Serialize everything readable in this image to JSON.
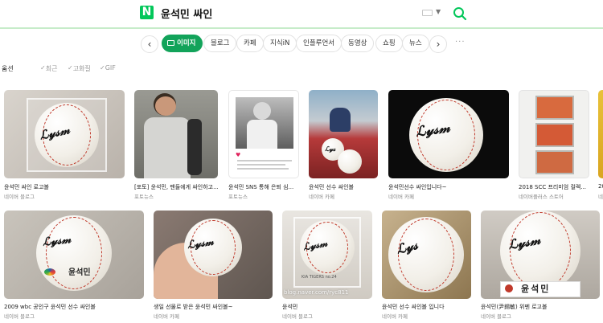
{
  "header": {
    "logo_letter": "N",
    "query": "윤석민 싸인"
  },
  "tabs": {
    "prev": "‹",
    "next": "›",
    "items": [
      "이미지",
      "블로그",
      "카페",
      "지식iN",
      "인플루언서",
      "동영상",
      "쇼핑",
      "뉴스"
    ],
    "more": "···"
  },
  "filters": {
    "options": "옵션",
    "recent": "최근",
    "hires": "고화질",
    "gif": "GIF"
  },
  "results_row1": [
    {
      "caption": "윤석민 싸인 로고볼",
      "source": "네이버 블로그"
    },
    {
      "caption": "[포토] 윤석민, 팬들에게 싸인하고...",
      "source": "포토뉴스"
    },
    {
      "caption": "윤석민 SNS 통해 은퇴 심...",
      "source": "포토뉴스"
    },
    {
      "caption": "윤석민 선수 싸인볼",
      "source": "네이버 카페"
    },
    {
      "caption": "윤석민선수 싸인입니다~",
      "source": "네이버 카페"
    },
    {
      "caption": "2018 SCC 프리미엄 컬렉...",
      "source": "네이버플러스 스토어"
    },
    {
      "caption": "20",
      "source": "네"
    }
  ],
  "results_row2": [
    {
      "caption": "2009 wbc 공인구 윤석민 선수 싸인볼",
      "source": "네이버 블로그"
    },
    {
      "caption": "생일 선물로 받은 윤석민 싸인볼~",
      "source": "네이버 카페"
    },
    {
      "caption": "윤석민",
      "source": "네이버 블로그"
    },
    {
      "caption": "윤석민 선수 싸인볼 입니다",
      "source": "네이버 카페"
    },
    {
      "caption": "윤석민(尹錫敏) 위펜 로고볼",
      "source": "네이버 블로그"
    }
  ],
  "image_text": {
    "name_plate": "윤석민",
    "watermark": "blog.naver.com/ryc811",
    "case_label": "KIA TIGERS no.24"
  },
  "colors": {
    "brand_green": "#03c75a",
    "active_tab": "#12a35a",
    "header_line": "#c6ecc9"
  }
}
